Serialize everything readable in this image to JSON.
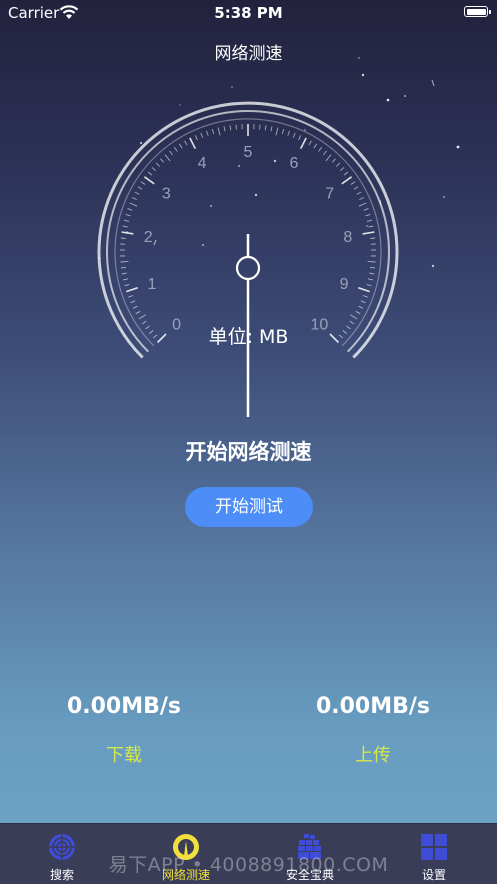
{
  "status_bar": {
    "carrier": "Carrier",
    "time": "5:38 PM"
  },
  "nav": {
    "title": "网络测速"
  },
  "gauge": {
    "ticks": [
      "0",
      "1",
      "2",
      "3",
      "4",
      "5",
      "6",
      "7",
      "8",
      "9",
      "10"
    ],
    "unit_text": "单位: MB",
    "value": 0
  },
  "main": {
    "title": "开始网络测速",
    "button_label": "开始测试"
  },
  "speeds": {
    "download": {
      "value": "0.00MB/s",
      "label": "下载"
    },
    "upload": {
      "value": "0.00MB/s",
      "label": "上传"
    }
  },
  "tabs": [
    {
      "label": "搜索",
      "icon": "radar-icon"
    },
    {
      "label": "网络测速",
      "icon": "speedometer-icon",
      "active": true
    },
    {
      "label": "安全宝典",
      "icon": "book-icon"
    },
    {
      "label": "设置",
      "icon": "grid-icon"
    }
  ],
  "watermark": "易下APP • 4008891800.COM",
  "colors": {
    "button": "#4d8df8",
    "accent": "#d5e84a",
    "tab_active": "#f1e03c",
    "tab_icon": "#3f4dd6"
  }
}
